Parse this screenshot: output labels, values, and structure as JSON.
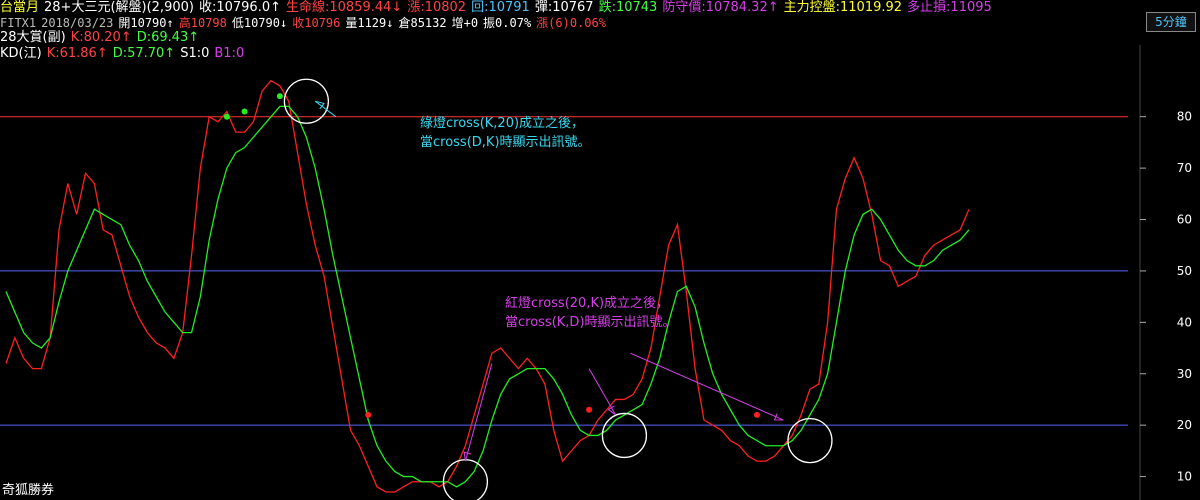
{
  "header": {
    "row1": [
      {
        "text": "台當月",
        "color": "#ffff33"
      },
      {
        "text": "28+大三元(解盤)(2,900)",
        "color": "#ffffff"
      },
      {
        "text": "收:10796.0↑",
        "color": "#ffffff"
      },
      {
        "text": "生命線:10859.44↓",
        "color": "#ff4444"
      },
      {
        "text": "漲:10802",
        "color": "#ff4444"
      },
      {
        "text": "回:10791",
        "color": "#4fc3f7"
      },
      {
        "text": "彈:10767",
        "color": "#ffffff"
      },
      {
        "text": "跌:10743",
        "color": "#44ff44"
      },
      {
        "text": "防守價:10784.32↑",
        "color": "#d640e8"
      },
      {
        "text": "主力控盤:11019.92",
        "color": "#ffff33"
      },
      {
        "text": "多止損:11095",
        "color": "#d640e8"
      }
    ],
    "row2": [
      {
        "text": "FITX1",
        "color": "#bbbbbb"
      },
      {
        "text": "2018/03/23",
        "color": "#bbbbbb"
      },
      {
        "text": "開10790↑",
        "color": "#ffffff"
      },
      {
        "text": "高10798",
        "color": "#ff4444"
      },
      {
        "text": "低10790↓",
        "color": "#ffffff"
      },
      {
        "text": "收10796",
        "color": "#ff4444"
      },
      {
        "text": "量1129↓",
        "color": "#ffffff"
      },
      {
        "text": "倉85132",
        "color": "#ffffff"
      },
      {
        "text": "增+0",
        "color": "#ffffff"
      },
      {
        "text": "振0.07%",
        "color": "#ffffff"
      },
      {
        "text": "漲(6)0.06%",
        "color": "#ff4444"
      }
    ],
    "row3": [
      {
        "text": "28大賞(副)",
        "color": "#ffffff"
      },
      {
        "text": "K:80.20↑",
        "color": "#ff4444"
      },
      {
        "text": "D:69.43↑",
        "color": "#44ff44"
      }
    ],
    "row4": [
      {
        "text": "KD(江)",
        "color": "#ffffff"
      },
      {
        "text": "K:61.86↑",
        "color": "#ff4444"
      },
      {
        "text": "D:57.70↑",
        "color": "#44ff44"
      },
      {
        "text": "S1:0",
        "color": "#ffffff"
      },
      {
        "text": "B1:0",
        "color": "#d640e8"
      }
    ],
    "timeframe_tab": "5分鐘"
  },
  "watermark": "奇狐勝券",
  "annotations": {
    "green_lines": [
      "綠燈cross(K,20)成立之後，",
      "當cross(D,K)時顯示出訊號。"
    ],
    "red_lines": [
      "紅燈cross(20,K)成立之後，",
      "當cross(K,D)時顯示出訊號。"
    ]
  },
  "colors": {
    "background": "#000000",
    "k_line": "#ff2020",
    "d_line": "#22ee22",
    "ref_line_80": "#ff3333",
    "ref_line_50": "#5566ff",
    "ref_line_20": "#5566ff",
    "axis_text": "#ffffff",
    "circle": "#ffffff",
    "cyan_arrow": "#39d8f0",
    "magenta_arrow": "#d640e8"
  },
  "chart_data": {
    "type": "line",
    "title": "KD(江)",
    "ylim": [
      7,
      92
    ],
    "yticks": [
      10,
      20,
      30,
      40,
      50,
      60,
      70,
      80
    ],
    "reference_lines": [
      80,
      50,
      20
    ],
    "x": [
      0,
      3,
      6,
      9,
      12,
      15,
      18,
      21,
      24,
      27,
      30,
      33,
      36,
      39,
      42,
      45,
      48,
      51,
      54,
      57,
      60,
      63,
      66,
      69,
      72,
      75,
      78,
      81,
      84,
      87,
      90,
      93,
      96,
      99,
      102,
      105,
      108,
      111,
      114,
      117,
      120,
      123,
      126,
      129,
      132,
      135,
      138,
      141,
      144,
      147,
      150,
      153,
      156,
      159,
      162,
      165,
      168,
      171,
      174,
      177,
      180,
      183,
      186,
      189,
      192,
      195,
      198,
      201,
      204,
      207,
      210,
      213,
      216,
      219,
      222,
      225,
      228,
      231,
      234,
      237,
      240,
      243,
      246,
      249,
      252,
      255,
      258,
      261,
      264,
      267,
      270,
      273,
      276,
      279,
      282,
      285,
      288,
      291,
      294,
      297,
      300,
      303,
      306,
      309,
      312,
      315,
      318,
      321,
      324,
      327,
      330,
      333,
      336,
      339,
      342,
      345,
      348,
      351,
      354,
      357,
      360,
      363,
      366,
      369,
      372,
      375,
      378,
      381
    ],
    "series": [
      {
        "name": "K",
        "values": [
          32,
          37,
          33,
          31,
          31,
          37,
          58,
          67,
          61,
          69,
          67,
          58,
          57,
          51,
          45,
          41,
          38,
          36,
          35,
          33,
          38,
          53,
          70,
          80,
          79,
          81,
          77,
          77,
          79,
          85,
          87,
          86,
          83,
          73,
          63,
          55,
          49,
          39,
          29,
          19,
          16,
          12,
          8,
          7,
          7,
          8,
          9,
          9,
          9,
          8,
          9,
          12,
          16,
          22,
          28,
          34,
          35,
          33,
          31,
          33,
          31,
          28,
          19,
          13,
          15,
          17,
          18,
          21,
          23,
          25,
          25,
          26,
          29,
          35,
          45,
          55,
          59,
          46,
          31,
          21,
          20,
          19,
          17,
          16,
          14,
          13,
          13,
          14,
          16,
          18,
          22,
          27,
          28,
          40,
          62,
          68,
          72,
          68,
          61,
          52,
          51,
          47,
          48,
          49,
          53,
          55,
          56,
          57,
          58,
          62
        ]
      },
      {
        "name": "D",
        "values": [
          46,
          42,
          38,
          36,
          35,
          37,
          44,
          50,
          54,
          58,
          62,
          61,
          60,
          59,
          55,
          52,
          48,
          45,
          42,
          40,
          38,
          38,
          45,
          56,
          64,
          70,
          73,
          74,
          76,
          78,
          80,
          82,
          82,
          80,
          76,
          70,
          62,
          53,
          45,
          37,
          29,
          21,
          16,
          13,
          11,
          10,
          10,
          9,
          9,
          9,
          9,
          8,
          9,
          11,
          15,
          21,
          26,
          29,
          30,
          31,
          31,
          31,
          29,
          26,
          22,
          19,
          18,
          18,
          19,
          21,
          22,
          23,
          24,
          28,
          33,
          40,
          46,
          47,
          43,
          36,
          30,
          26,
          23,
          20,
          18,
          17,
          16,
          16,
          16,
          17,
          19,
          22,
          25,
          30,
          40,
          50,
          57,
          61,
          62,
          60,
          57,
          54,
          52,
          51,
          51,
          52,
          54,
          55,
          56,
          58
        ]
      }
    ],
    "signals": [
      {
        "type": "green",
        "x": 75,
        "y": 80
      },
      {
        "type": "green",
        "x": 81,
        "y": 81
      },
      {
        "type": "green",
        "x": 93,
        "y": 84
      },
      {
        "type": "red",
        "x": 123,
        "y": 22
      },
      {
        "type": "red",
        "x": 198,
        "y": 23
      },
      {
        "type": "red",
        "x": 255,
        "y": 22
      }
    ],
    "circled_points": [
      {
        "x": 102,
        "y": 83
      },
      {
        "x": 156,
        "y": 9
      },
      {
        "x": 210,
        "y": 18
      },
      {
        "x": 273,
        "y": 17
      }
    ],
    "arrows": [
      {
        "color": "cyan",
        "from": [
          112,
          80
        ],
        "to": [
          105,
          83
        ]
      },
      {
        "color": "magenta",
        "from": [
          165,
          32
        ],
        "to": [
          156,
          13
        ]
      },
      {
        "color": "magenta",
        "from": [
          198,
          31
        ],
        "to": [
          207,
          22
        ]
      },
      {
        "color": "magenta",
        "from": [
          212,
          34
        ],
        "to": [
          264,
          21
        ]
      }
    ]
  }
}
